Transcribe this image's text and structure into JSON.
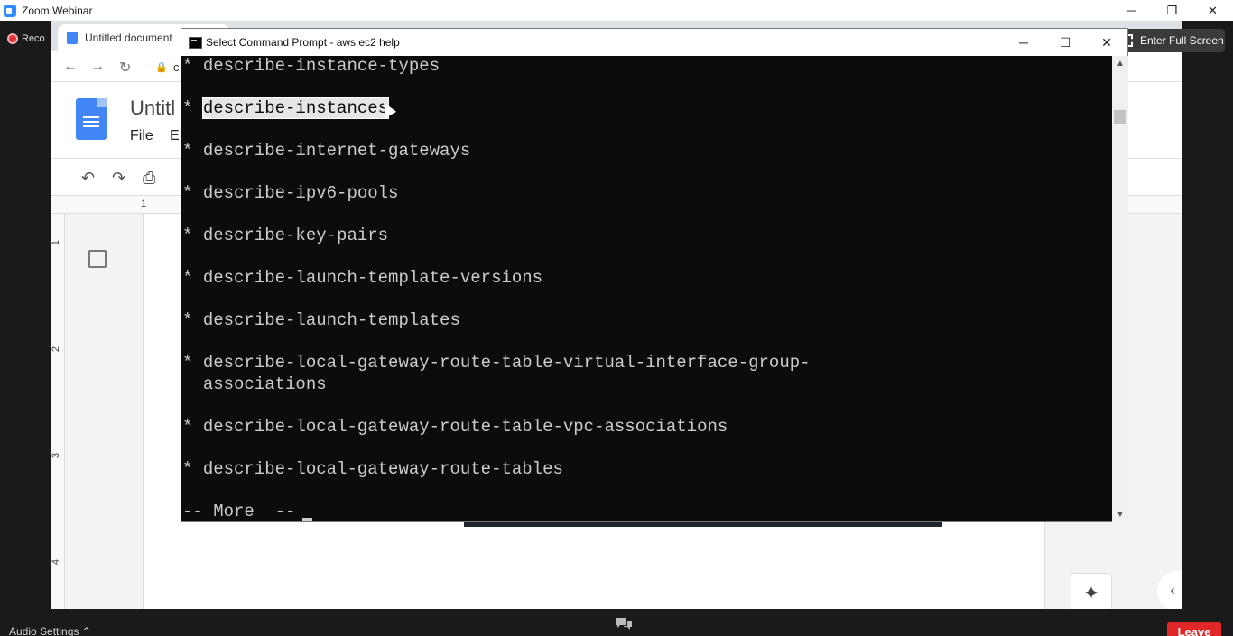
{
  "zoom": {
    "window_title": "Zoom Webinar",
    "recording_label": "Reco",
    "fullscreen_label": "Enter Full Screen",
    "audio_settings_label": "Audio Settings",
    "leave_label": "Leave",
    "leave_color": "#e02828",
    "win_minimize": "─",
    "win_restore": "❐",
    "win_close": "✕",
    "caret_up": "⌃"
  },
  "browser": {
    "tab_title": "Untitled document",
    "back": "←",
    "forward": "→",
    "reload": "↻",
    "lock": "🔒",
    "url_fragment": "c",
    "kebab": "⋮"
  },
  "docs": {
    "title": "Untitl",
    "menu_file": "File",
    "menu_edit": "E",
    "undo": "↶",
    "redo": "↷",
    "print": "⎙",
    "ruler_h": "1",
    "ruler_v": [
      "1",
      "2",
      "3",
      "4"
    ],
    "collapse": "⌃",
    "explore": "✦",
    "side_toggle": "‹"
  },
  "cmd": {
    "title": "Select Command Prompt - aws  ec2  help",
    "minimize": "─",
    "maximize": "☐",
    "close": "✕",
    "scroll_up": "▲",
    "scroll_down": "▼",
    "lines": [
      {
        "bullet": "* ",
        "text": "describe-instance-types",
        "selected": false
      },
      {
        "bullet": "",
        "text": "",
        "selected": false
      },
      {
        "bullet": "* ",
        "text": "describe-instances",
        "selected": true
      },
      {
        "bullet": "",
        "text": "",
        "selected": false
      },
      {
        "bullet": "* ",
        "text": "describe-internet-gateways",
        "selected": false
      },
      {
        "bullet": "",
        "text": "",
        "selected": false
      },
      {
        "bullet": "* ",
        "text": "describe-ipv6-pools",
        "selected": false
      },
      {
        "bullet": "",
        "text": "",
        "selected": false
      },
      {
        "bullet": "* ",
        "text": "describe-key-pairs",
        "selected": false
      },
      {
        "bullet": "",
        "text": "",
        "selected": false
      },
      {
        "bullet": "* ",
        "text": "describe-launch-template-versions",
        "selected": false
      },
      {
        "bullet": "",
        "text": "",
        "selected": false
      },
      {
        "bullet": "* ",
        "text": "describe-launch-templates",
        "selected": false
      },
      {
        "bullet": "",
        "text": "",
        "selected": false
      },
      {
        "bullet": "* ",
        "text": "describe-local-gateway-route-table-virtual-interface-group-",
        "selected": false
      },
      {
        "bullet": "  ",
        "text": "associations",
        "selected": false
      },
      {
        "bullet": "",
        "text": "",
        "selected": false
      },
      {
        "bullet": "* ",
        "text": "describe-local-gateway-route-table-vpc-associations",
        "selected": false
      },
      {
        "bullet": "",
        "text": "",
        "selected": false
      },
      {
        "bullet": "* ",
        "text": "describe-local-gateway-route-tables",
        "selected": false
      },
      {
        "bullet": "",
        "text": "",
        "selected": false
      },
      {
        "bullet": "",
        "text": "-- More  --",
        "selected": false
      }
    ]
  }
}
